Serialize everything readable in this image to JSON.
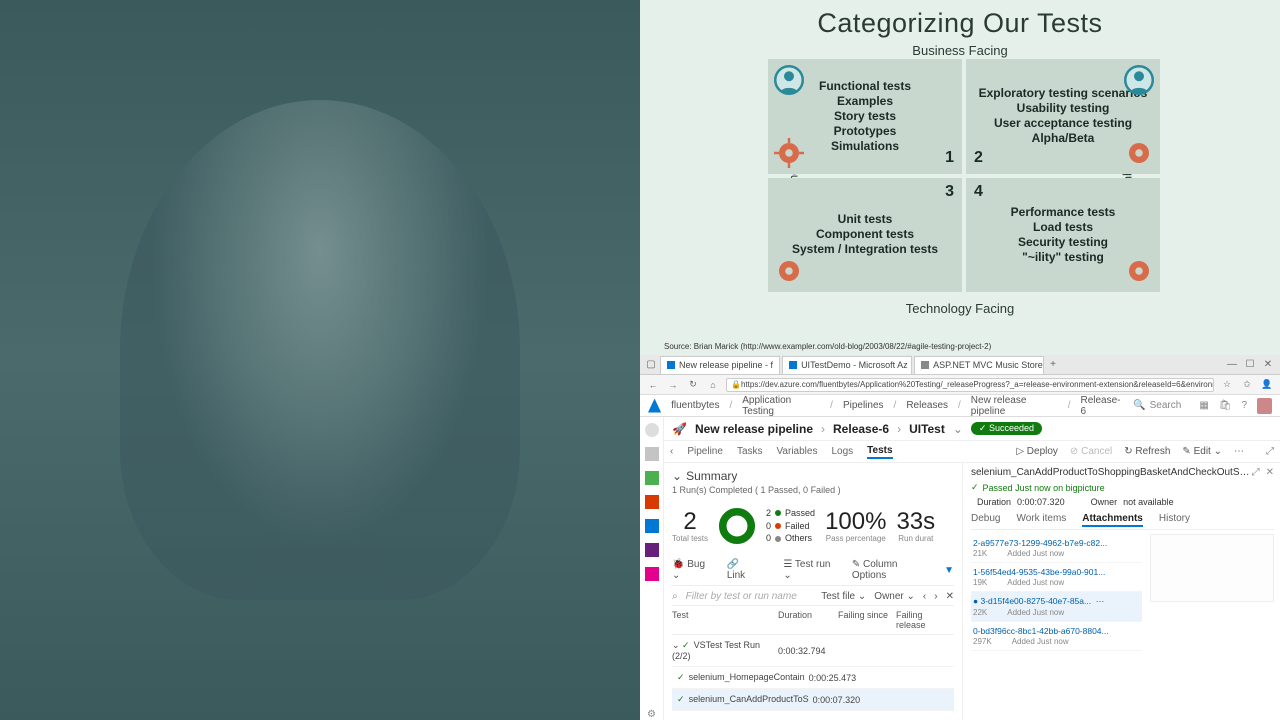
{
  "slide": {
    "title": "Categorizing Our Tests",
    "axes": {
      "top": "Business Facing",
      "bottom": "Technology Facing",
      "left": "Supporting the Team",
      "right": "Critique Product"
    },
    "quadrants": {
      "q1": {
        "num": "1",
        "lines": [
          "Functional tests",
          "Examples",
          "Story tests",
          "Prototypes",
          "Simulations"
        ]
      },
      "q2": {
        "num": "2",
        "lines": [
          "Exploratory testing scenarios",
          "Usability testing",
          "User acceptance testing",
          "Alpha/Beta"
        ]
      },
      "q3": {
        "num": "3",
        "lines": [
          "Unit tests",
          "Component tests",
          "System / Integration tests"
        ]
      },
      "q4": {
        "num": "4",
        "lines": [
          "Performance tests",
          "Load tests",
          "Security testing",
          "\"~ility\" testing"
        ]
      }
    },
    "source": "Source: Brian Marick (http://www.exampler.com/old-blog/2003/08/22/#agile-testing-project-2)"
  },
  "browser": {
    "tabs": [
      {
        "label": "New release pipeline - f"
      },
      {
        "label": "UITestDemo - Microsoft Az"
      },
      {
        "label": "ASP.NET MVC Music Store"
      }
    ],
    "url": "https://dev.azure.com/fluentbytes/Application%20Testing/_releaseProgress?_a=release-environment-extension&releaseId=6&environmentId=1"
  },
  "ado": {
    "crumbs": [
      "fluentbytes",
      "Application Testing",
      "Pipelines",
      "Releases",
      "New release pipeline",
      "Release-6"
    ],
    "search_ph": "Search",
    "pipeHeader": {
      "name": "New release pipeline",
      "release": "Release-6",
      "stage": "UITest",
      "badge": "✓ Succeeded"
    },
    "subTabs": [
      "Pipeline",
      "Tasks",
      "Variables",
      "Logs",
      "Tests"
    ],
    "actions": {
      "deploy": "Deploy",
      "cancel": "Cancel",
      "refresh": "Refresh",
      "edit": "Edit"
    },
    "summary": {
      "title": "Summary",
      "runline": "1 Run(s) Completed ( 1 Passed, 0 Failed )",
      "total": {
        "n": "2",
        "l": "Total tests"
      },
      "legend": {
        "passed": {
          "n": "2",
          "l": "Passed",
          "c": "#107c10"
        },
        "failed": {
          "n": "0",
          "l": "Failed",
          "c": "#d83b01"
        },
        "others": {
          "n": "0",
          "l": "Others",
          "c": "#888"
        }
      },
      "passpct": {
        "n": "100%",
        "l": "Pass percentage"
      },
      "rundur": {
        "n": "33s",
        "l": "Run durat"
      },
      "tools": {
        "bug": "Bug",
        "link": "Link",
        "group": "Test run",
        "cols": "Column Options"
      },
      "filter_ph": "Filter by test or run name",
      "filter_file": "Test file",
      "filter_owner": "Owner",
      "columns": {
        "test": "Test",
        "dur": "Duration",
        "fs": "Failing since",
        "fr": "Failing release"
      },
      "rows": [
        {
          "name": "VSTest Test Run (2/2)",
          "dur": "0:00:32.794",
          "group": true
        },
        {
          "name": "selenium_HomepageContain",
          "dur": "0:00:25.473"
        },
        {
          "name": "selenium_CanAddProductToS",
          "dur": "0:00:07.320",
          "sel": true
        }
      ]
    },
    "detail": {
      "title": "selenium_CanAddProductToShoppingBasketAndCheckOutSelenium",
      "status": "Passed Just now on bigpicture",
      "duration": "0:00:07.320",
      "duration_l": "Duration",
      "owner": "not available",
      "owner_l": "Owner",
      "tabs": [
        "Debug",
        "Work items",
        "Attachments",
        "History"
      ],
      "activeTab": 2,
      "attachments": [
        {
          "name": "2-a9577e73-1299-4962-b7e9-c82...",
          "size": "21K",
          "added": "Added Just now"
        },
        {
          "name": "1-56f54ed4-9535-43be-99a0-901...",
          "size": "19K",
          "added": "Added Just now"
        },
        {
          "name": "3-d15f4e00-8275-40e7-85a...",
          "size": "22K",
          "added": "Added Just now",
          "sel": true
        },
        {
          "name": "0-bd3f96cc-8bc1-42bb-a670-8804...",
          "size": "297K",
          "added": "Added Just now"
        }
      ]
    }
  }
}
